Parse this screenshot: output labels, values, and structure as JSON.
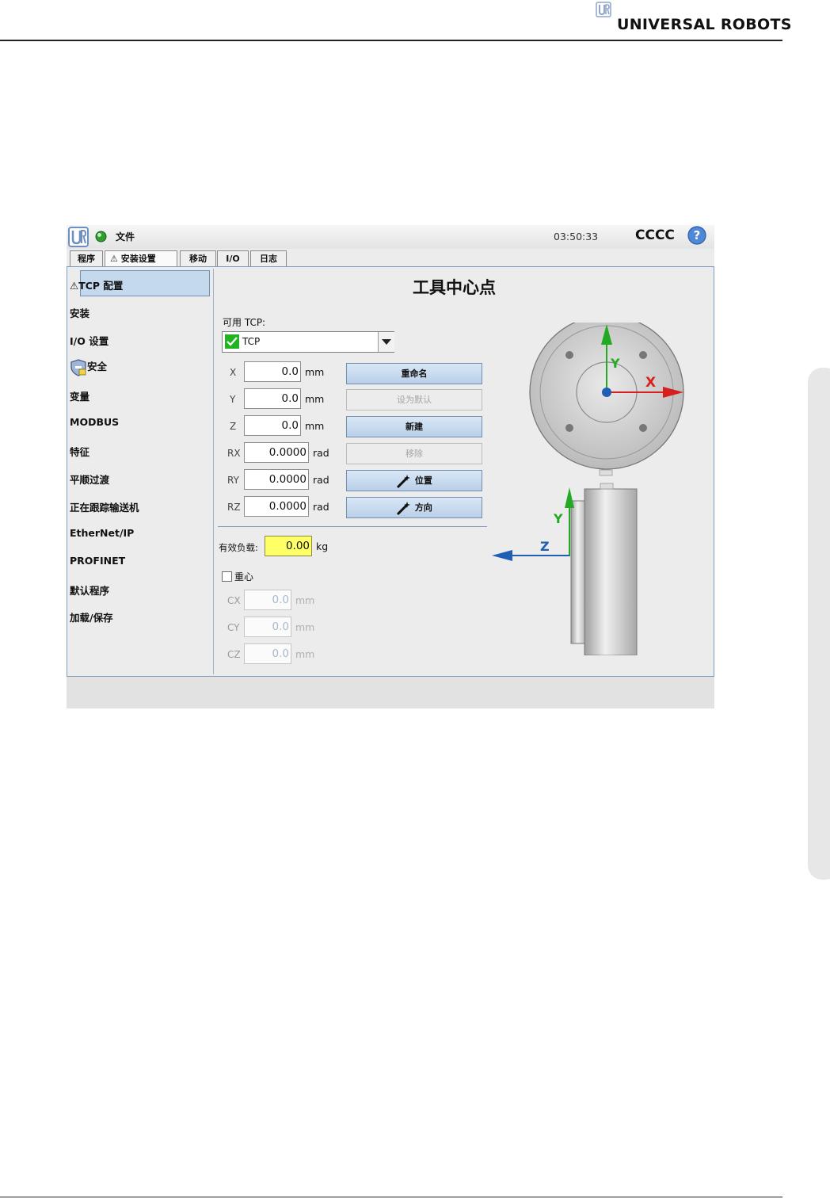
{
  "page_header": {
    "brand": "UNIVERSAL ROBOTS"
  },
  "topbar": {
    "menu_file": "文件",
    "time": "03:50:33",
    "robot_name": "CCCC"
  },
  "tabs": [
    {
      "label": "程序"
    },
    {
      "label": "安装设置"
    },
    {
      "label": "移动"
    },
    {
      "label": "I/O"
    },
    {
      "label": "日志"
    }
  ],
  "sidebar": {
    "items": [
      {
        "label": "TCP 配置"
      },
      {
        "label": "安装"
      },
      {
        "label": "I/O 设置"
      },
      {
        "label": "安全"
      },
      {
        "label": "变量"
      },
      {
        "label": "MODBUS"
      },
      {
        "label": "特征"
      },
      {
        "label": "平顺过渡"
      },
      {
        "label": "正在跟踪输送机"
      },
      {
        "label": "EtherNet/IP"
      },
      {
        "label": "PROFINET"
      },
      {
        "label": "默认程序"
      },
      {
        "label": "加载/保存"
      }
    ]
  },
  "main": {
    "title": "工具中心点",
    "available_tcp_label": "可用 TCP:",
    "selected_tcp": "TCP",
    "fields": [
      {
        "label": "X",
        "value": "0.0",
        "unit": "mm"
      },
      {
        "label": "Y",
        "value": "0.0",
        "unit": "mm"
      },
      {
        "label": "Z",
        "value": "0.0",
        "unit": "mm"
      },
      {
        "label": "RX",
        "value": "0.0000",
        "unit": "rad"
      },
      {
        "label": "RY",
        "value": "0.0000",
        "unit": "rad"
      },
      {
        "label": "RZ",
        "value": "0.0000",
        "unit": "rad"
      }
    ],
    "buttons": {
      "rename": "重命名",
      "set_default": "设为默认",
      "new": "新建",
      "remove": "移除",
      "position": "位置",
      "orientation": "方向"
    },
    "payload_label": "有效负载:",
    "payload_value": "0.00",
    "payload_unit": "kg",
    "cog_label": "重心",
    "cog_fields": [
      {
        "label": "CX",
        "value": "0.0",
        "unit": "mm"
      },
      {
        "label": "CY",
        "value": "0.0",
        "unit": "mm"
      },
      {
        "label": "CZ",
        "value": "0.0",
        "unit": "mm"
      }
    ]
  },
  "diagram": {
    "axis_x": "X",
    "axis_y": "Y",
    "axis_z": "Z"
  },
  "colors": {
    "accent_blue": "#2f7fd8",
    "highlight_yellow": "#ffff66",
    "axis_red": "#d62020",
    "axis_green": "#22aa22",
    "axis_blue": "#1f5fb4"
  }
}
